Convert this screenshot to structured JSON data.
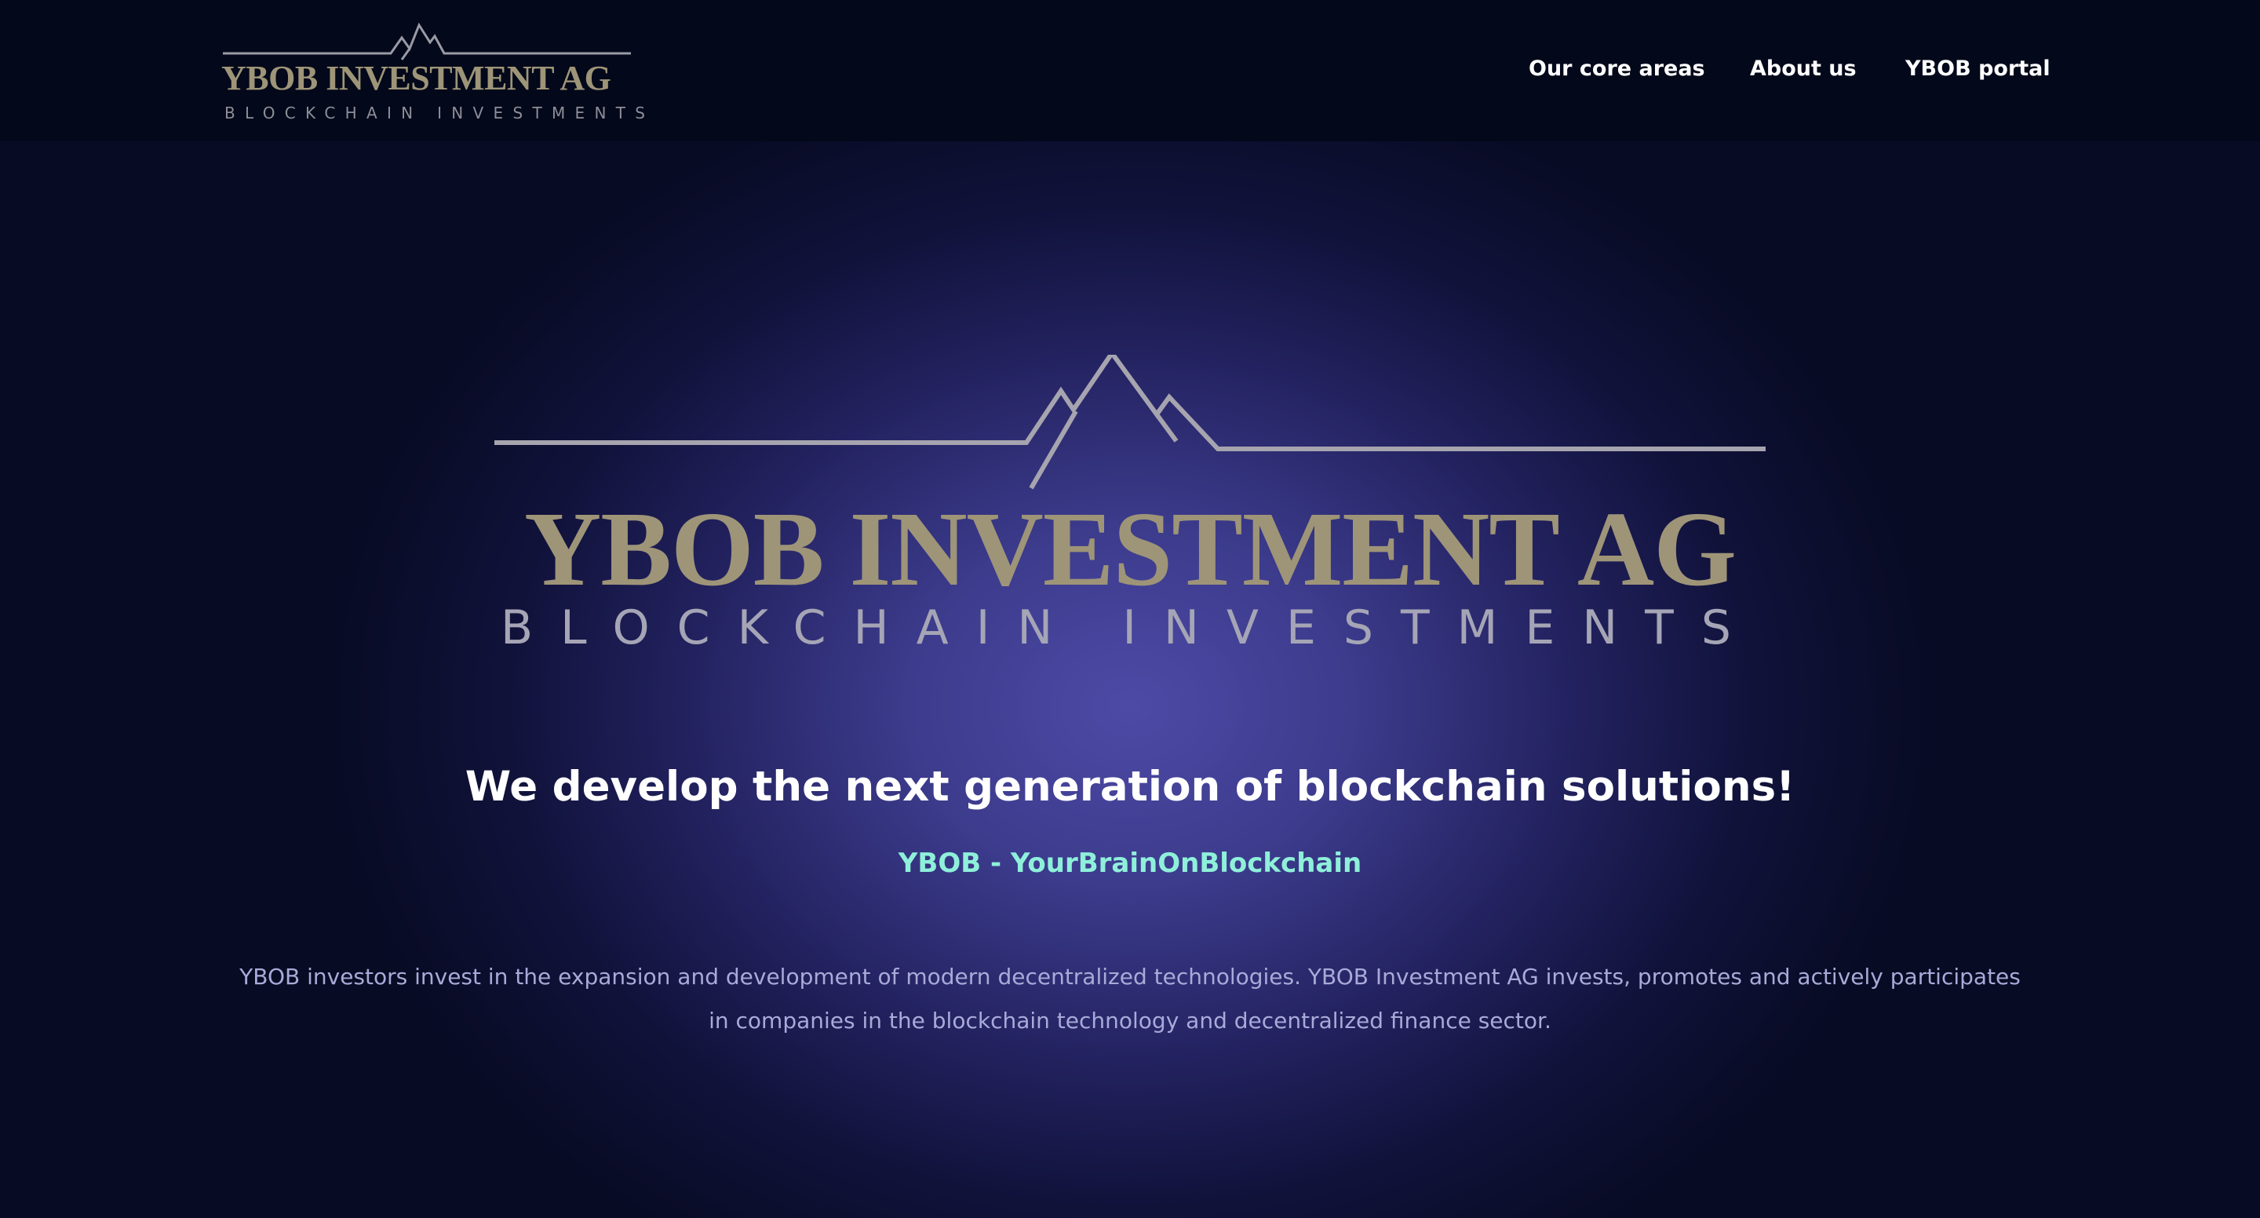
{
  "header": {
    "logo": {
      "title": "YBOB INVESTMENT AG",
      "subtitle": "BLOCKCHAIN INVESTMENTS"
    },
    "nav": [
      {
        "label": "Our core areas"
      },
      {
        "label": "About us"
      },
      {
        "label": "YBOB portal"
      }
    ]
  },
  "hero": {
    "logo": {
      "title": "YBOB INVESTMENT AG",
      "subtitle": "BLOCKCHAIN INVESTMENTS"
    },
    "headline": "We develop the next generation of blockchain solutions!",
    "tagline": "YBOB - YourBrainOnBlockchain",
    "description": "YBOB investors invest in the expansion and development of modern decentralized technologies. YBOB Investment AG invests, promotes and actively participates in companies in the blockchain technology and decentralized finance sector."
  },
  "colors": {
    "header_bg": "#03081a",
    "logo_gold": "#9e9478",
    "tagline_accent": "#8ff0da",
    "body_text": "#a8aad8"
  }
}
